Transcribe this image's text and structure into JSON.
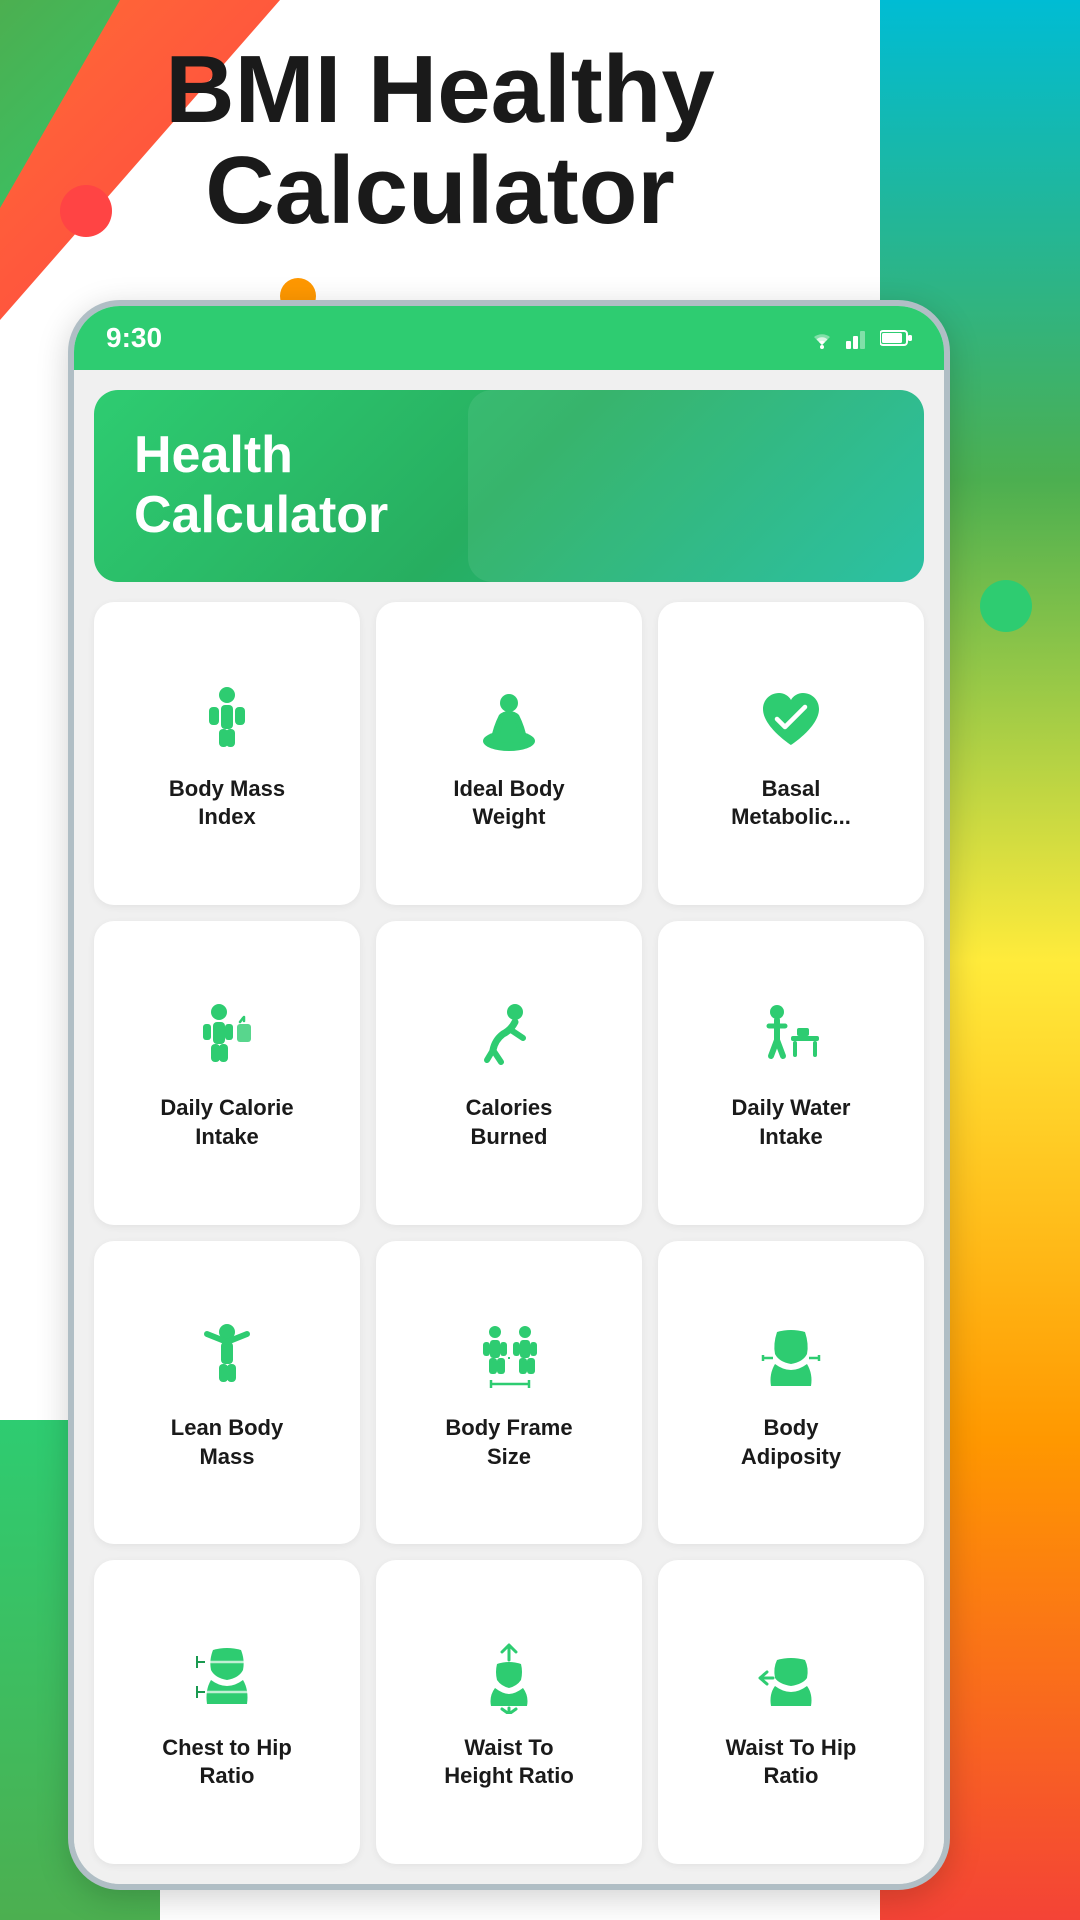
{
  "page": {
    "title_line1": "BMI Healthy",
    "title_line2": "Calculator"
  },
  "status_bar": {
    "time": "9:30"
  },
  "header": {
    "title": "Health\nCalculator"
  },
  "grid_items": [
    {
      "id": "bmi",
      "label": "Body Mass\nIndex",
      "icon": "person"
    },
    {
      "id": "ibw",
      "label": "Ideal Body\nWeight",
      "icon": "scale-person"
    },
    {
      "id": "bmr",
      "label": "Basal\nMetabolic...",
      "icon": "heart-check"
    },
    {
      "id": "dci",
      "label": "Daily Calorie\nIntake",
      "icon": "person-drink"
    },
    {
      "id": "cb",
      "label": "Calories\nBurned",
      "icon": "person-bend"
    },
    {
      "id": "dwi",
      "label": "Daily Water\nIntake",
      "icon": "person-desk"
    },
    {
      "id": "lbm",
      "label": "Lean Body\nMass",
      "icon": "person-arms-up"
    },
    {
      "id": "bfs",
      "label": "Body Frame\nSize",
      "icon": "two-persons"
    },
    {
      "id": "ba",
      "label": "Body\nAdiposity",
      "icon": "torso-wide"
    },
    {
      "id": "chr",
      "label": "Chest to Hip\nRatio",
      "icon": "torso-lines"
    },
    {
      "id": "wthr",
      "label": "Waist To\nHeight Ratio",
      "icon": "torso-arrow-up"
    },
    {
      "id": "wthr2",
      "label": "Waist To Hip\nRatio",
      "icon": "torso-arrow-left"
    }
  ],
  "colors": {
    "primary": "#2ecc71",
    "dark": "#27ae60",
    "text_dark": "#1a1a1a"
  }
}
